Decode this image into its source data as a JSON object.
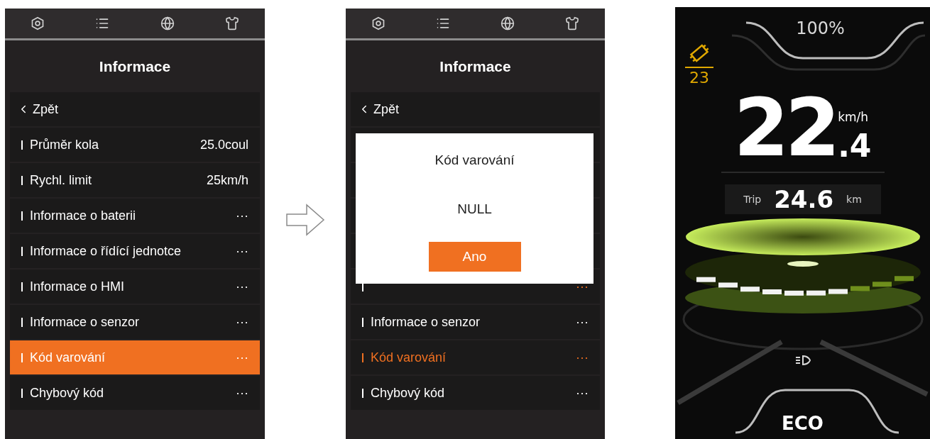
{
  "screens": [
    {
      "kind": "menu",
      "title": "Informace",
      "back": "Zpět",
      "items": [
        {
          "label": "Průměr kola",
          "value": "25.0coul",
          "selected": false,
          "accent_value": false
        },
        {
          "label": "Rychl. limit",
          "value": "25km/h",
          "selected": false,
          "accent_value": false
        },
        {
          "label": "Informace o baterii",
          "value": "···",
          "selected": false,
          "accent_value": false
        },
        {
          "label": "Informace o řídící jednotce",
          "value": "···",
          "selected": false,
          "accent_value": false
        },
        {
          "label": "Informace o HMI",
          "value": "···",
          "selected": false,
          "accent_value": false
        },
        {
          "label": "Informace o senzor",
          "value": "···",
          "selected": false,
          "accent_value": false
        },
        {
          "label": "Kód varování",
          "value": "···",
          "selected": true,
          "accent_value": false
        },
        {
          "label": "Chybový kód",
          "value": "···",
          "selected": false,
          "accent_value": false
        }
      ]
    },
    {
      "kind": "menu_with_dialog",
      "title": "Informace",
      "back": "Zpět",
      "items": [
        {
          "value": "···",
          "selected": false,
          "accent_value": true
        },
        {
          "label": "Informace o senzor",
          "value": "···",
          "selected": false,
          "accent_value": false
        },
        {
          "label": "Kód varování",
          "value": "···",
          "selected": true,
          "accent_value": false
        },
        {
          "label": "Chybový kód",
          "value": "···",
          "selected": false,
          "accent_value": false
        }
      ],
      "dialog": {
        "title": "Kód varování",
        "message": "NULL",
        "button": "Ano"
      }
    },
    {
      "kind": "dashboard",
      "battery": "100%",
      "warning_code": "23",
      "speed_whole": "22",
      "speed_decimal": ".4",
      "speed_unit": "km/h",
      "trip_label": "Trip",
      "trip_value": "24.6",
      "trip_unit": "km",
      "assist": {
        "level": 0.7
      },
      "mode": "ECO"
    }
  ]
}
